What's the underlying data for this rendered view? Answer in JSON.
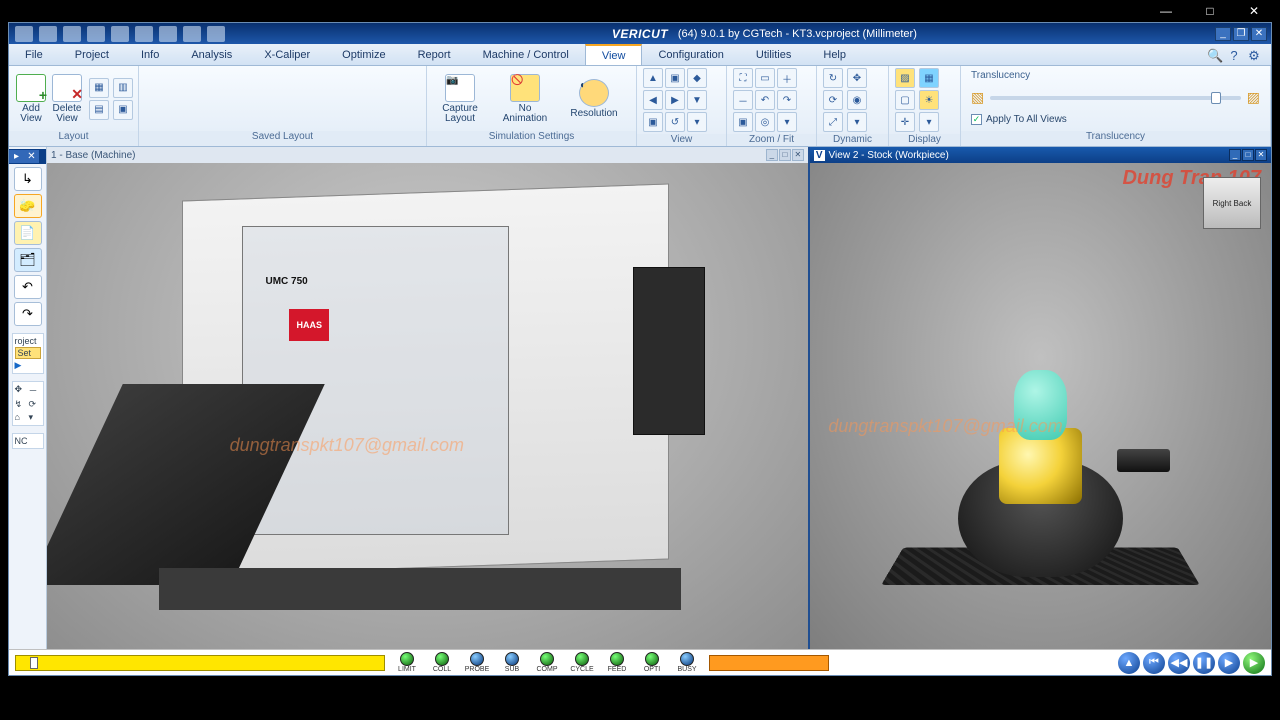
{
  "window_controls": {
    "min": "—",
    "max": "□",
    "close": "✕"
  },
  "app": {
    "brand": "VERICUT",
    "title": "(64)  9.0.1 by CGTech - KT3.vcproject (Millimeter)"
  },
  "menus": [
    "File",
    "Project",
    "Info",
    "Analysis",
    "X-Caliper",
    "Optimize",
    "Report",
    "Machine / Control",
    "View",
    "Configuration",
    "Utilities",
    "Help"
  ],
  "active_menu": "View",
  "ribbon": {
    "layout": {
      "label": "Layout",
      "add": "Add\nView",
      "delete": "Delete\nView"
    },
    "saved": {
      "label": "Saved Layout"
    },
    "sim": {
      "label": "Simulation Settings",
      "capture": "Capture\nLayout",
      "anim": "No\nAnimation",
      "res": "Resolution"
    },
    "view": {
      "label": "View"
    },
    "zoom": {
      "label": "Zoom / Fit"
    },
    "dynamic": {
      "label": "Dynamic"
    },
    "display": {
      "label": "Display"
    },
    "translucency": {
      "label": "Translucency",
      "title": "Translucency",
      "apply": "Apply To All Views"
    }
  },
  "left_panel": {
    "project": "roject",
    "setup": "Set",
    "nc": "NC"
  },
  "views": {
    "v1": {
      "title": "1 - Base (Machine)",
      "model": "UMC 750",
      "brand": "HAAS",
      "wm": "dungtranspkt107@gmail.com"
    },
    "v2": {
      "title": "View 2 - Stock (Workpiece)",
      "logo": "Dung Tran 107",
      "wm": "dungtranspkt107@gmail.com",
      "gizmo": "Right  Back"
    }
  },
  "status": {
    "leds": [
      "LIMIT",
      "COLL",
      "PROBE",
      "SUB",
      "COMP",
      "CYCLE",
      "FEED",
      "OPTI",
      "BUSY"
    ]
  }
}
